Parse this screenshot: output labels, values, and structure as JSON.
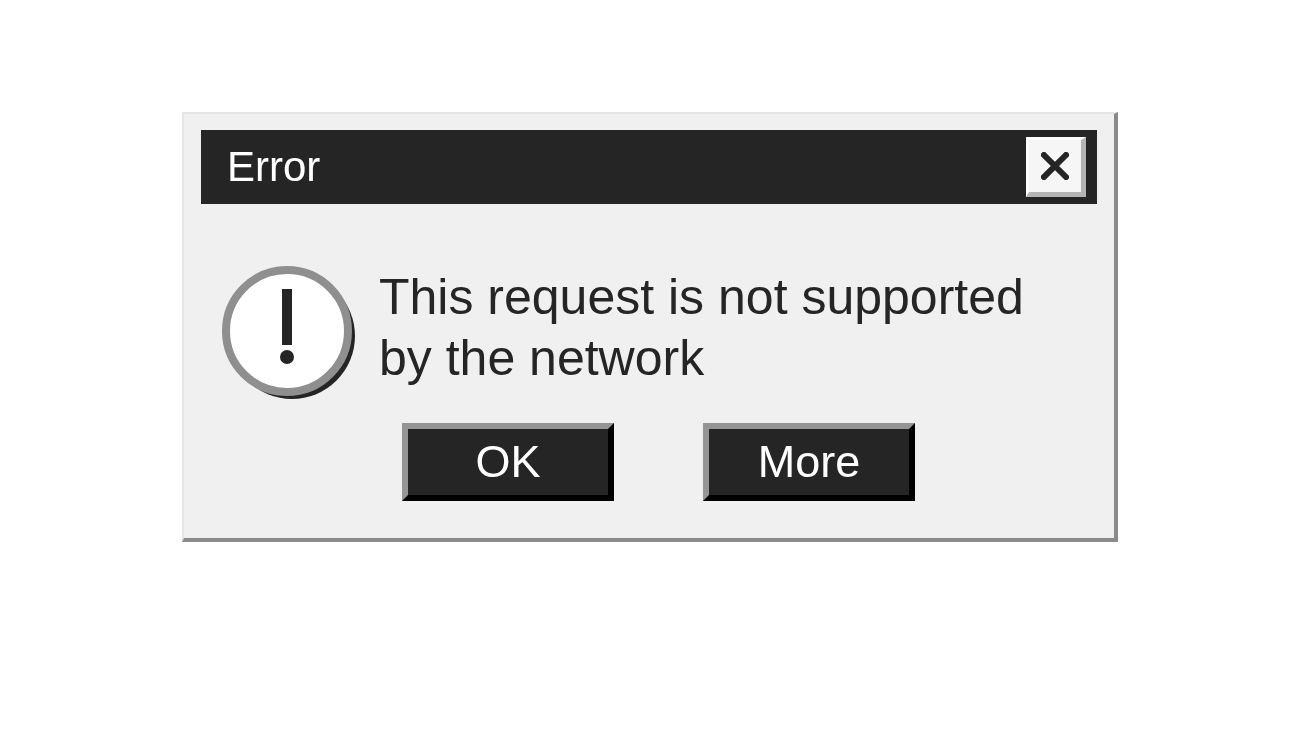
{
  "window": {
    "title": "Error"
  },
  "message": "This request is not supported by the network",
  "buttons": [
    {
      "label": "OK"
    },
    {
      "label": "More"
    }
  ]
}
